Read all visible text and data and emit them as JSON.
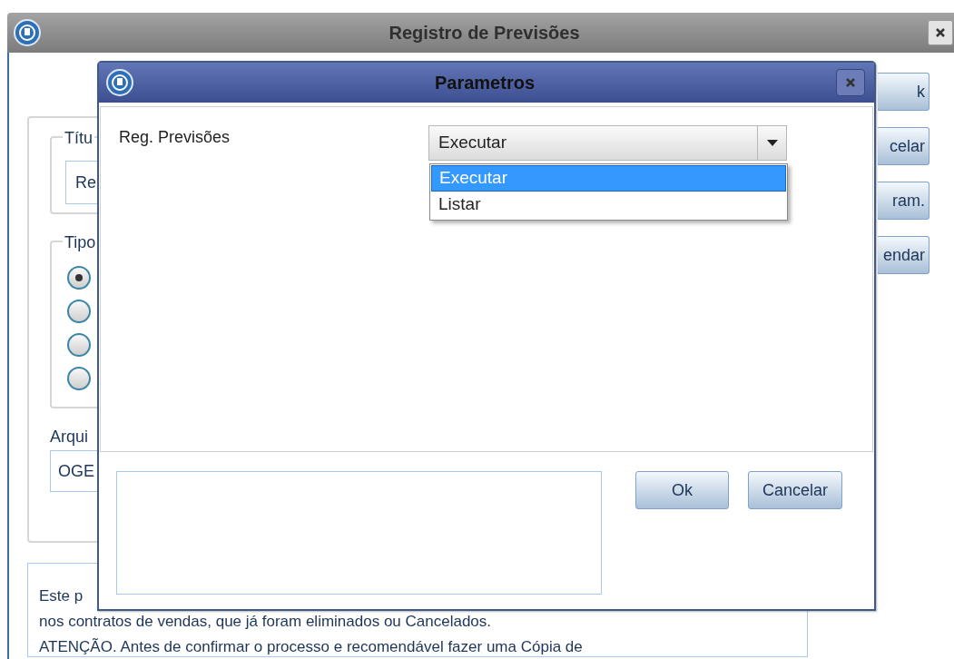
{
  "main_window": {
    "title": "Registro de Previsões",
    "titulo_group": {
      "legend": "Títu",
      "field_value": "Re"
    },
    "tipo_group": {
      "legend": "Tipo",
      "options": [
        {
          "selected": true
        },
        {
          "selected": false
        },
        {
          "selected": false
        },
        {
          "selected": false
        }
      ]
    },
    "arquivo": {
      "label": "Arqui",
      "value": "OGE"
    },
    "side_buttons": [
      "k",
      "celar",
      "ram.",
      "endar"
    ],
    "memo_lines": [
      "Este p",
      "nos contratos de vendas, que já foram eliminados ou Cancelados.",
      "ATENÇÃO. Antes de confirmar o processo e recomendável fazer uma Cópia de"
    ]
  },
  "dialog": {
    "title": "Parametros",
    "field_label": "Reg. Previsões",
    "select_value": "Executar",
    "options": [
      {
        "label": "Executar",
        "selected": true
      },
      {
        "label": "Listar",
        "selected": false
      }
    ],
    "buttons": [
      "Ok",
      "Cancelar"
    ]
  }
}
